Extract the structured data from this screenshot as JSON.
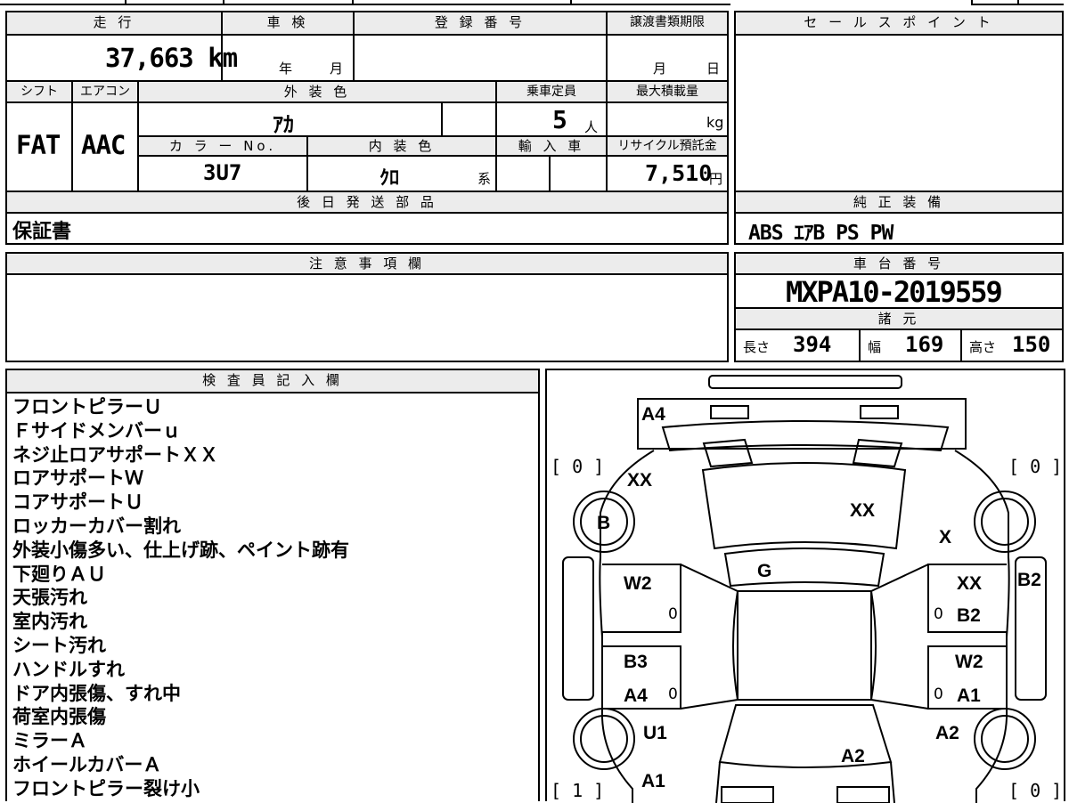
{
  "vehicle": {
    "mileage_label": "走 行",
    "mileage_value": "37,663 km",
    "inspection_label": "車 検",
    "year_unit": "年",
    "month_unit": "月",
    "registration_label": "登 録 番 号",
    "transfer_label": "譲渡書類期限",
    "month_unit2": "月",
    "day_unit": "日",
    "shift_label": "シフト",
    "shift_value": "FAT",
    "aircon_label": "エアコン",
    "aircon_value": "AAC",
    "exterior_color_label": "外 装 色",
    "exterior_color_value": "ｱｶ",
    "capacity_label": "乗車定員",
    "capacity_value": "5",
    "capacity_unit": "人",
    "max_load_label": "最大積載量",
    "max_load_unit": "kg",
    "color_no_label": "カ ラ ー No.",
    "color_no_value": "3U7",
    "interior_color_label": "内 装 色",
    "interior_color_value": "ｸﾛ",
    "interior_color_suffix": "系",
    "import_label": "輸 入 車",
    "recycle_label": "リサイクル預託金",
    "recycle_value": "7,510",
    "recycle_unit": "円",
    "later_parts_label": "後 日 発 送 部 品",
    "later_parts_value": "保証書"
  },
  "sales_point_label": "セ ー ル ス ポ イ ン ト",
  "genuine_equipment_label": "純 正 装 備",
  "genuine_equipment_value": "ABS ｴｱB PS PW",
  "notes_label": "注 意 事 項 欄",
  "chassis_label": "車 台 番 号",
  "chassis_value": "MXPA10-2019559",
  "specs_label": "諸 元",
  "specs": {
    "length_label": "長さ",
    "length_value": "394",
    "width_label": "幅",
    "width_value": "169",
    "height_label": "高さ",
    "height_value": "150"
  },
  "inspector_label": "検 査 員 記 入 欄",
  "inspector_notes": [
    "フロントピラーＵ",
    "Ｆサイドメンバーｕ",
    "ネジ止ロアサポートＸＸ",
    "ロアサポートＷ",
    "コアサポートＵ",
    "ロッカーカバー割れ",
    "外装小傷多い、仕上げ跡、ペイント跡有",
    "下廻りＡＵ",
    "天張汚れ",
    "室内汚れ",
    "シート汚れ",
    "ハンドルすれ",
    "ドア内張傷、すれ中",
    "荷室内張傷",
    "ミラーＡ",
    "ホイールカバーＡ",
    "フロントピラー裂け小"
  ],
  "diagram": {
    "bracket_top_left": "[ 0 ]",
    "bracket_top_right": "[ 0 ]",
    "bracket_bottom_left": "[ 1 ]",
    "bracket_bottom_right": "[ 0 ]",
    "marks": {
      "a4_top": "A4",
      "xx_left": "XX",
      "xx_center": "XX",
      "b_left": "B",
      "x_right": "X",
      "g_center": "G",
      "w2_left": "W2",
      "xx_right": "XX",
      "b2_right_panel": "B2",
      "b2_right": "B2",
      "b3_left": "B3",
      "w2_right": "W2",
      "a4_left": "A4",
      "a1_right": "A1",
      "u1_left": "U1",
      "a2_right": "A2",
      "a2_center": "A2",
      "a1_left": "A1",
      "zero_left_1": "0",
      "zero_left_2": "0",
      "zero_right_1": "0",
      "zero_right_2": "0"
    }
  }
}
